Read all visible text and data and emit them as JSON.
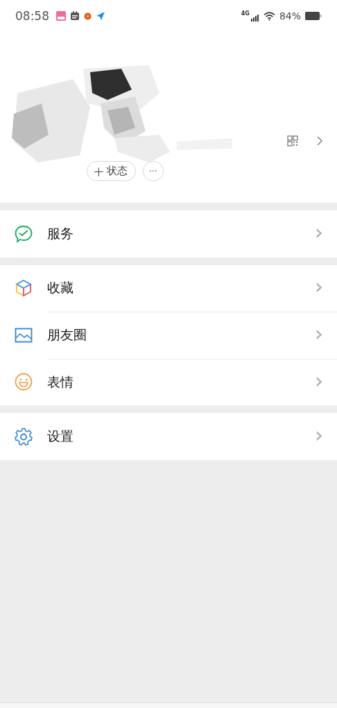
{
  "status_bar": {
    "time": "08:58",
    "network": "4G",
    "battery": "84%"
  },
  "profile": {
    "status_button": {
      "icon": "+",
      "label": "状态"
    },
    "more_button": "···"
  },
  "groups": [
    {
      "items": [
        {
          "kind": "service",
          "label": "服务",
          "chevron": "›"
        }
      ]
    },
    {
      "items": [
        {
          "kind": "favorites",
          "label": "收藏",
          "chevron": "›"
        },
        {
          "kind": "moments",
          "label": "朋友圈",
          "chevron": "›"
        },
        {
          "kind": "stickers",
          "label": "表情",
          "chevron": "›"
        }
      ]
    },
    {
      "items": [
        {
          "kind": "settings",
          "label": "设置",
          "chevron": "›"
        }
      ]
    }
  ]
}
